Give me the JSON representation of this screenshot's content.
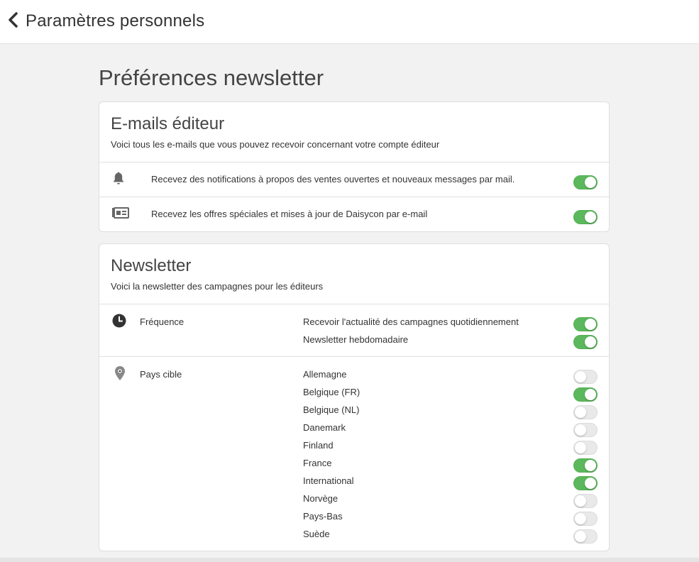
{
  "header": {
    "title": "Paramètres personnels"
  },
  "page": {
    "title": "Préférences newsletter"
  },
  "publisher_emails": {
    "title": "E-mails éditeur",
    "subtitle": "Voici tous les e-mails que vous pouvez recevoir concernant votre compte éditeur",
    "items": [
      {
        "icon": "bell-icon",
        "text": "Recevez des notifications à propos des ventes ouvertes et nouveaux messages par mail.",
        "enabled": true
      },
      {
        "icon": "newspaper-icon",
        "text": "Recevez les offres spéciales et mises à jour de Daisycon par e-mail",
        "enabled": true
      }
    ]
  },
  "newsletter": {
    "title": "Newsletter",
    "subtitle": "Voici la newsletter des campagnes pour les éditeurs",
    "frequency": {
      "label": "Fréquence",
      "icon": "clock-icon",
      "options": [
        {
          "label": "Recevoir l'actualité des campagnes quotidiennement",
          "enabled": true
        },
        {
          "label": "Newsletter hebdomadaire",
          "enabled": true
        }
      ]
    },
    "countries": {
      "label": "Pays cible",
      "icon": "map-pin-icon",
      "options": [
        {
          "label": "Allemagne",
          "enabled": false
        },
        {
          "label": "Belgique (FR)",
          "enabled": true
        },
        {
          "label": "Belgique (NL)",
          "enabled": false
        },
        {
          "label": "Danemark",
          "enabled": false
        },
        {
          "label": "Finland",
          "enabled": false
        },
        {
          "label": "France",
          "enabled": true
        },
        {
          "label": "International",
          "enabled": true
        },
        {
          "label": "Norvège",
          "enabled": false
        },
        {
          "label": "Pays-Bas",
          "enabled": false
        },
        {
          "label": "Suède",
          "enabled": false
        }
      ]
    }
  },
  "colors": {
    "toggle_on": "#5cb85c",
    "toggle_off": "#e9e9e9",
    "background": "#f2f2f2"
  }
}
